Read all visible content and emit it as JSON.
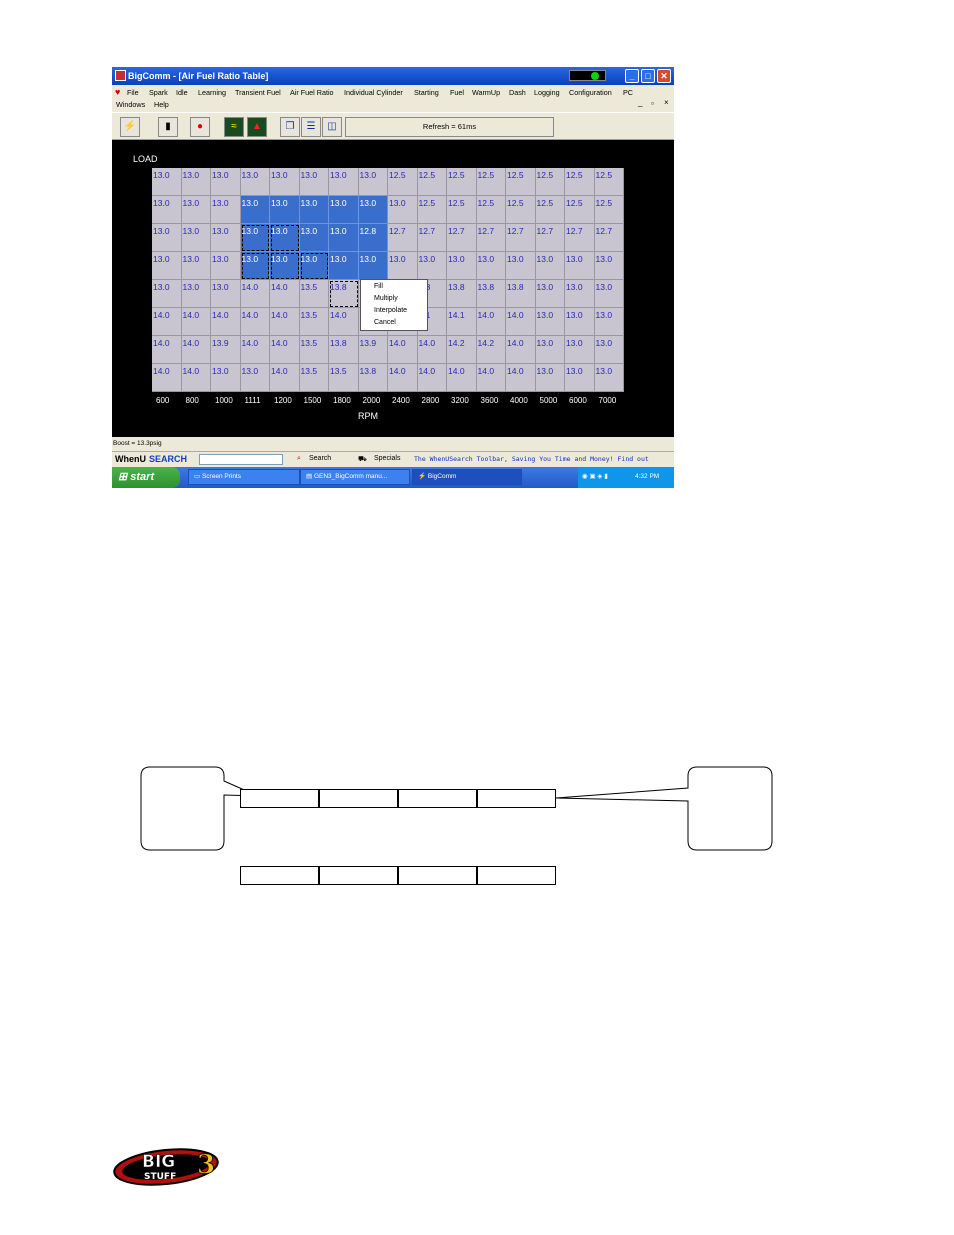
{
  "window": {
    "title": "BigComm - [Air Fuel Ratio Table]",
    "min": "_",
    "max": "□",
    "close": "✕"
  },
  "menu": {
    "row1": [
      "File",
      "Spark",
      "Idle",
      "Learning",
      "Transient Fuel",
      "Air Fuel Ratio",
      "Individual Cylinder",
      "Starting",
      "Fuel",
      "WarmUp",
      "Dash",
      "Logging",
      "Configuration",
      "PC"
    ],
    "row2": [
      "Windows",
      "Help"
    ],
    "mdi": [
      "_",
      "▫",
      "×"
    ]
  },
  "toolbar": {
    "refresh": "Refresh = 61ms"
  },
  "table": {
    "load_label": "LOAD",
    "rpm_label": "RPM",
    "rpm": [
      "600",
      "800",
      "1000",
      "1111",
      "1200",
      "1500",
      "1800",
      "2000",
      "2400",
      "2800",
      "3200",
      "3600",
      "4000",
      "5000",
      "6000",
      "7000"
    ],
    "rows": [
      [
        "13.0",
        "13.0",
        "13.0",
        "13.0",
        "13.0",
        "13.0",
        "13.0",
        "13.0",
        "12.5",
        "12.5",
        "12.5",
        "12.5",
        "12.5",
        "12.5",
        "12.5",
        "12.5"
      ],
      [
        "13.0",
        "13.0",
        "13.0",
        "13.0",
        "13.0",
        "13.0",
        "13.0",
        "13.0",
        "13.0",
        "12.5",
        "12.5",
        "12.5",
        "12.5",
        "12.5",
        "12.5",
        "12.5"
      ],
      [
        "13.0",
        "13.0",
        "13.0",
        "13.0",
        "13.0",
        "13.0",
        "13.0",
        "12.8",
        "12.7",
        "12.7",
        "12.7",
        "12.7",
        "12.7",
        "12.7",
        "12.7",
        "12.7"
      ],
      [
        "13.0",
        "13.0",
        "13.0",
        "13.0",
        "13.0",
        "13.0",
        "13.0",
        "13.0",
        "13.0",
        "13.0",
        "13.0",
        "13.0",
        "13.0",
        "13.0",
        "13.0",
        "13.0"
      ],
      [
        "13.0",
        "13.0",
        "13.0",
        "14.0",
        "14.0",
        "13.5",
        "13.8",
        "",
        "",
        "3.8",
        "13.8",
        "13.8",
        "13.8",
        "13.0",
        "13.0",
        "13.0"
      ],
      [
        "14.0",
        "14.0",
        "14.0",
        "14.0",
        "14.0",
        "13.5",
        "14.0",
        "",
        "",
        "1.1",
        "14.1",
        "14.0",
        "14.0",
        "13.0",
        "13.0",
        "13.0"
      ],
      [
        "14.0",
        "14.0",
        "13.9",
        "14.0",
        "14.0",
        "13.5",
        "13.8",
        "13.9",
        "14.0",
        "14.0",
        "14.2",
        "14.2",
        "14.0",
        "13.0",
        "13.0",
        "13.0"
      ],
      [
        "14.0",
        "14.0",
        "13.0",
        "13.0",
        "14.0",
        "13.5",
        "13.5",
        "13.8",
        "14.0",
        "14.0",
        "14.0",
        "14.0",
        "14.0",
        "13.0",
        "13.0",
        "13.0"
      ]
    ]
  },
  "context_menu": [
    "Fill",
    "Multiply",
    "Interpolate",
    "Cancel"
  ],
  "status": {
    "boost": "Boost = 13.3psig"
  },
  "whenusearch": {
    "brand_a": "WhenU",
    "brand_b": "SEARCH",
    "search": "Search",
    "specials": "Specials",
    "ticker": "The WhenUSearch Toolbar, Saving You Time and Money! Find out"
  },
  "taskbar": {
    "start": "start",
    "tasks": [
      "Screen Prints",
      "GEN3_BigComm manu...",
      "BigComm"
    ],
    "time": "4:32 PM"
  },
  "logo": {
    "line1": "BIG",
    "line2": "STUFF",
    "mark": "3"
  }
}
